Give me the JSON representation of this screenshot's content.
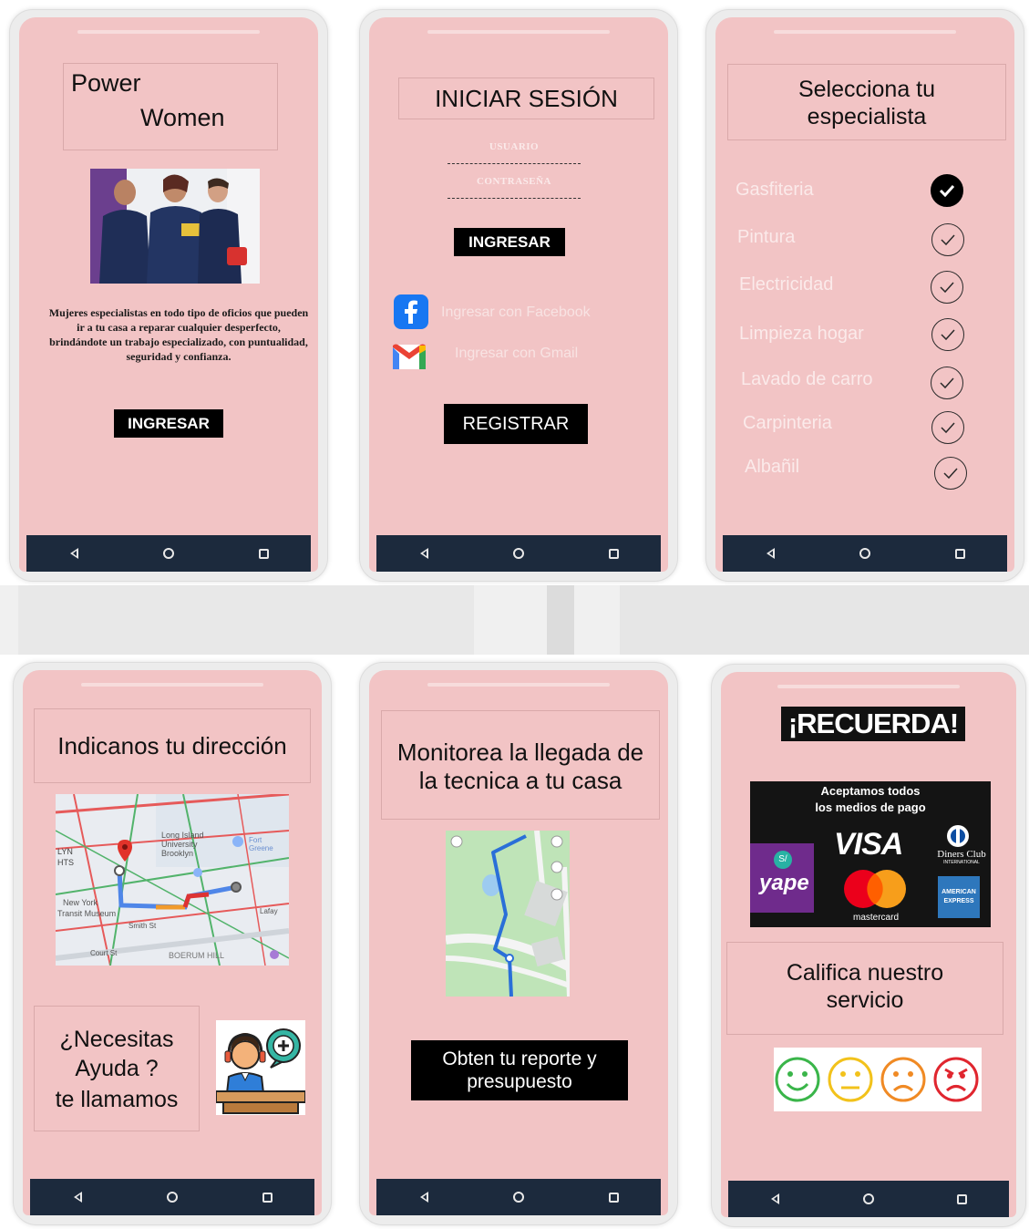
{
  "screens": {
    "welcome": {
      "title_line1": "Power",
      "title_line2": "Women",
      "description": "Mujeres especialistas en todo tipo de oficios que pueden ir a tu casa a reparar cualquier desperfecto, brindándote un trabajo especializado, con puntualidad, seguridad y confianza.",
      "button_label": "INGRESAR"
    },
    "login": {
      "title": "INICIAR SESIÓN",
      "user_placeholder": "USUARIO",
      "password_placeholder": "CONTRASEÑA",
      "login_button": "INGRESAR",
      "facebook_label": "Ingresar con Facebook",
      "gmail_label": "Ingresar con Gmail",
      "register_button": "REGISTRAR"
    },
    "specialist": {
      "title": "Selecciona tu especialista",
      "items": [
        {
          "label": "Gasfiteria",
          "selected": true
        },
        {
          "label": "Pintura",
          "selected": false
        },
        {
          "label": "Electricidad",
          "selected": false
        },
        {
          "label": "Limpieza hogar",
          "selected": false
        },
        {
          "label": "Lavado de carro",
          "selected": false
        },
        {
          "label": "Carpinteria",
          "selected": false
        },
        {
          "label": "Albañil",
          "selected": false
        }
      ]
    },
    "address": {
      "title": "Indicanos tu dirección",
      "map_labels": {
        "long_island": "Long Island University Brooklyn",
        "fort_greene": "Fort Greene",
        "new_york": "New York",
        "museum": "Transit Museum",
        "lyn": "LYN",
        "its": "HTS",
        "smith": "Smith St",
        "court": "Court St",
        "hill": "BOERUM HILL",
        "latay": "Lafay"
      },
      "help_line1": "¿Necesitas",
      "help_line2": "Ayuda ?",
      "help_line3": "te llamamos"
    },
    "monitor": {
      "title": "Monitorea la llegada de la tecnica  a tu casa",
      "report_button": "Obten tu reporte y presupuesto"
    },
    "remember": {
      "banner": "¡RECUERDA!",
      "payment_title_line1": "Aceptamos todos",
      "payment_title_line2": "los medios de pago",
      "yape_small": "S/",
      "yape_label": "yape",
      "visa_label": "VISA",
      "mastercard_label": "mastercard",
      "diners_label": "Diners Club",
      "diners_sub": "INTERNATIONAL",
      "amex_line1": "AMERICAN",
      "amex_line2": "EXPRESS",
      "rate_title": "Califica nuestro servicio",
      "ratings": [
        {
          "name": "happy",
          "color": "#3ab54a"
        },
        {
          "name": "neutral",
          "color": "#f2c21b"
        },
        {
          "name": "sad",
          "color": "#f08a24"
        },
        {
          "name": "angry",
          "color": "#e0262f"
        }
      ]
    }
  }
}
